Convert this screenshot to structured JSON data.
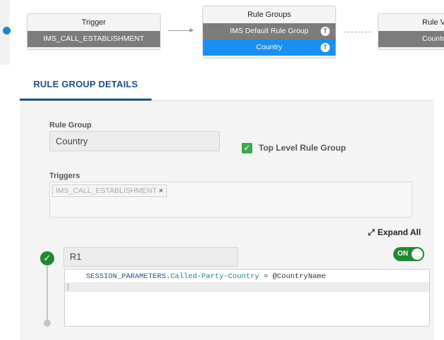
{
  "flow": {
    "trigger": {
      "title": "Trigger",
      "value": "IMS_CALL_ESTABLISHMENT"
    },
    "rule_groups": {
      "title": "Rule Groups",
      "items": [
        "IMS Default Rule Group",
        "Country"
      ],
      "icon": "T"
    },
    "rule_values": {
      "title": "Rule Va",
      "value": "Countr"
    }
  },
  "tabs": {
    "active": "RULE GROUP DETAILS"
  },
  "form": {
    "rule_group_label": "Rule Group",
    "rule_group_value": "Country",
    "top_level_label": "Top Level Rule Group",
    "triggers_label": "Triggers",
    "trigger_chip": "IMS_CALL_ESTABLISHMENT",
    "chip_remove": "×",
    "expand_all": "Expand All"
  },
  "rule": {
    "name": "R1",
    "toggle": "ON",
    "code": {
      "obj": "SESSION_PARAMETERS",
      "dot": ".",
      "prop": "Called-Party-Country",
      "op": " = ",
      "var": "@CountryName"
    }
  },
  "colors": {
    "accent": "#1a8ff0",
    "tab": "#1f4e8a",
    "success": "#1e8a34"
  },
  "icons": {
    "check": "✓",
    "expand": "⤢"
  }
}
